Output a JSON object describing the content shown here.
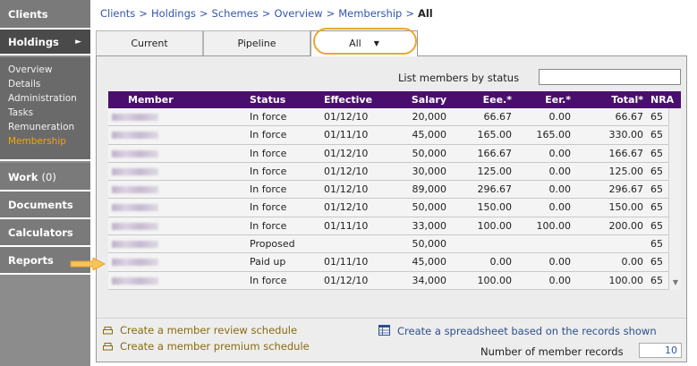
{
  "sidebar": {
    "clients": "Clients",
    "holdings": "Holdings",
    "holdings_arrow": "►",
    "submenu": [
      "Overview",
      "Details",
      "Administration",
      "Tasks",
      "Remuneration",
      "Membership"
    ],
    "work": "Work",
    "work_count": "(0)",
    "documents": "Documents",
    "calculators": "Calculators",
    "reports": "Reports"
  },
  "breadcrumb": {
    "items": [
      "Clients",
      "Holdings",
      "Schemes",
      "Overview",
      "Membership"
    ],
    "separator": ">",
    "current": "All"
  },
  "tabs": {
    "current": "Current",
    "pipeline": "Pipeline",
    "all": "All",
    "all_indicator": "▼"
  },
  "filter": {
    "label": "List members by status",
    "value": ""
  },
  "table": {
    "headers": [
      "Member",
      "Status",
      "Effective",
      "Salary",
      "Eee.*",
      "Eer.*",
      "Total*",
      "NRA"
    ],
    "rows": [
      {
        "status": "In force",
        "effective": "01/12/10",
        "salary": "20,000",
        "eee": "66.67",
        "eer": "0.00",
        "total": "66.67",
        "nra": "65"
      },
      {
        "status": "In force",
        "effective": "01/11/10",
        "salary": "45,000",
        "eee": "165.00",
        "eer": "165.00",
        "total": "330.00",
        "nra": "65"
      },
      {
        "status": "In force",
        "effective": "01/12/10",
        "salary": "50,000",
        "eee": "166.67",
        "eer": "0.00",
        "total": "166.67",
        "nra": "65"
      },
      {
        "status": "In force",
        "effective": "01/12/10",
        "salary": "30,000",
        "eee": "125.00",
        "eer": "0.00",
        "total": "125.00",
        "nra": "65"
      },
      {
        "status": "In force",
        "effective": "01/12/10",
        "salary": "89,000",
        "eee": "296.67",
        "eer": "0.00",
        "total": "296.67",
        "nra": "65"
      },
      {
        "status": "In force",
        "effective": "01/12/10",
        "salary": "50,000",
        "eee": "150.00",
        "eer": "0.00",
        "total": "150.00",
        "nra": "65"
      },
      {
        "status": "In force",
        "effective": "01/11/10",
        "salary": "33,000",
        "eee": "100.00",
        "eer": "100.00",
        "total": "200.00",
        "nra": "65"
      },
      {
        "status": "Proposed",
        "effective": "",
        "salary": "50,000",
        "eee": "",
        "eer": "",
        "total": "",
        "nra": "65"
      },
      {
        "status": "Paid up",
        "effective": "01/11/10",
        "salary": "45,000",
        "eee": "0.00",
        "eer": "0.00",
        "total": "0.00",
        "nra": "65"
      },
      {
        "status": "In force",
        "effective": "01/12/10",
        "salary": "34,000",
        "eee": "100.00",
        "eer": "0.00",
        "total": "100.00",
        "nra": "65"
      }
    ]
  },
  "actions": {
    "review_schedule": "Create a member review schedule",
    "premium_schedule": "Create a member premium schedule",
    "spreadsheet": "Create a spreadsheet based on the records shown"
  },
  "records": {
    "label": "Number of member records",
    "value": "10"
  },
  "colors": {
    "header_bg": "#4a0f6e",
    "highlight": "#eba72d",
    "active_link": "#f3a800",
    "link": "#3355aa"
  },
  "icons": {
    "review": "printer-icon",
    "premium": "printer-icon",
    "spreadsheet": "spreadsheet-icon",
    "row_pointer": "arrow-right-icon"
  }
}
